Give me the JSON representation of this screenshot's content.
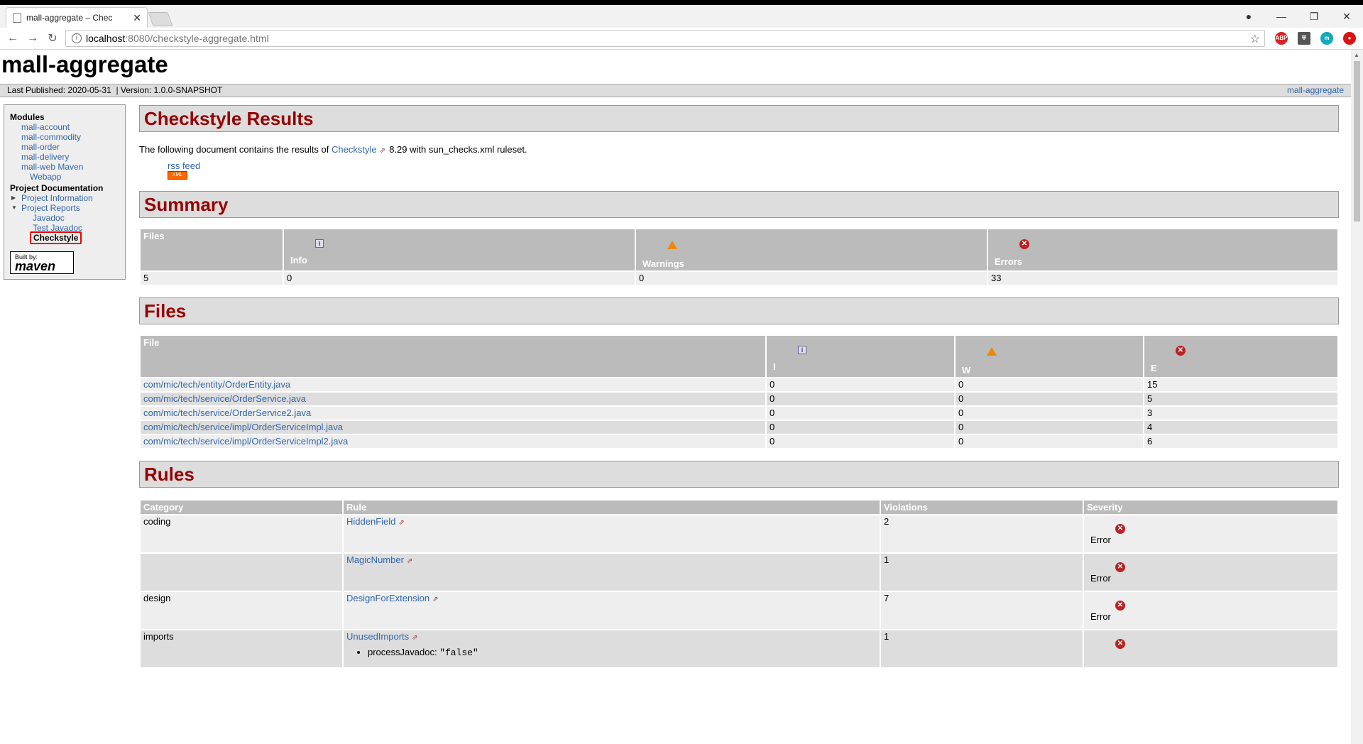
{
  "browser": {
    "tab_title": "mall-aggregate – Chec",
    "url_host": "localhost",
    "url_path": ":8080/checkstyle-aggregate.html"
  },
  "site": {
    "title": "mall-aggregate",
    "published": "Last Published: 2020-05-31",
    "version": "| Version: 1.0.0-SNAPSHOT",
    "breadcrumb_right": "mall-aggregate"
  },
  "sidebar": {
    "modules_heading": "Modules",
    "modules": [
      "mall-account",
      "mall-commodity",
      "mall-order",
      "mall-delivery",
      "mall-web Maven",
      "Webapp"
    ],
    "doc_heading": "Project Documentation",
    "project_information": "Project Information",
    "project_reports": "Project Reports",
    "reports": [
      "Javadoc",
      "Test Javadoc"
    ],
    "current": "Checkstyle",
    "built_by": "Built by:",
    "maven": "maven"
  },
  "main": {
    "heading": "Checkstyle Results",
    "intro_before": "The following document contains the results of",
    "intro_link": "Checkstyle",
    "intro_after": "8.29 with sun_checks.xml ruleset.",
    "rss_label": "rss feed",
    "xml_badge": "XML",
    "summary_heading": "Summary",
    "summary_headers": [
      "Files",
      "Info",
      "Warnings",
      "Errors"
    ],
    "summary_values": [
      "5",
      "0",
      "0",
      "33"
    ],
    "files_heading": "Files",
    "files_headers": [
      "File",
      "I",
      "W",
      "E"
    ],
    "files": [
      {
        "file": "com/mic/tech/entity/OrderEntity.java",
        "i": "0",
        "w": "0",
        "e": "15"
      },
      {
        "file": "com/mic/tech/service/OrderService.java",
        "i": "0",
        "w": "0",
        "e": "5"
      },
      {
        "file": "com/mic/tech/service/OrderService2.java",
        "i": "0",
        "w": "0",
        "e": "3"
      },
      {
        "file": "com/mic/tech/service/impl/OrderServiceImpl.java",
        "i": "0",
        "w": "0",
        "e": "4"
      },
      {
        "file": "com/mic/tech/service/impl/OrderServiceImpl2.java",
        "i": "0",
        "w": "0",
        "e": "6"
      }
    ],
    "rules_heading": "Rules",
    "rules_headers": [
      "Category",
      "Rule",
      "Violations",
      "Severity"
    ],
    "rules": [
      {
        "category": "coding",
        "rule": "HiddenField",
        "violations": "2",
        "severity": "Error"
      },
      {
        "category": "",
        "rule": "MagicNumber",
        "violations": "1",
        "severity": "Error"
      },
      {
        "category": "design",
        "rule": "DesignForExtension",
        "violations": "7",
        "severity": "Error"
      },
      {
        "category": "imports",
        "rule": "UnusedImports",
        "violations": "1",
        "severity": ""
      }
    ],
    "rule_param_name": "processJavadoc:",
    "rule_param_value": "\"false\""
  },
  "colors": {
    "heading": "#990000",
    "link": "#3366aa",
    "th_bg": "#bbbbbb"
  }
}
